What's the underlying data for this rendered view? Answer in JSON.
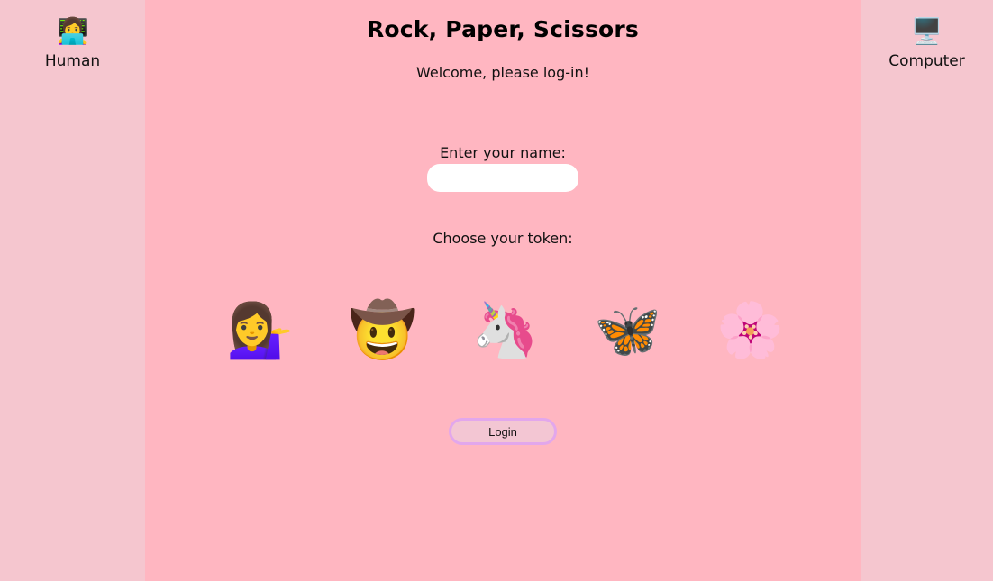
{
  "players": {
    "left": {
      "avatar_icon": "woman-technologist-icon",
      "avatar_glyph": "👩‍💻",
      "name": "Human"
    },
    "right": {
      "avatar_icon": "desktop-computer-icon",
      "avatar_glyph": "🖥️",
      "name": "Computer"
    }
  },
  "game": {
    "title": "Rock, Paper, Scissors",
    "welcome": "Welcome, please log-in!"
  },
  "login_form": {
    "name_label": "Enter your name:",
    "name_value": "",
    "token_label": "Choose your token:",
    "tokens": [
      {
        "name": "person-tipping-hand-icon",
        "glyph": "💁‍♀️"
      },
      {
        "name": "cowboy-face-icon",
        "glyph": "🤠"
      },
      {
        "name": "unicorn-icon",
        "glyph": "🦄"
      },
      {
        "name": "butterfly-icon",
        "glyph": "🦋"
      },
      {
        "name": "cherry-blossom-icon",
        "glyph": "🌸"
      }
    ],
    "login_label": "Login"
  },
  "colors": {
    "side_panel": "#f5c6cf",
    "main_background": "#ffb6c1",
    "input_background": "#ffffff",
    "button_background": "#f3c6d3",
    "button_border": "#e2a7ec"
  }
}
